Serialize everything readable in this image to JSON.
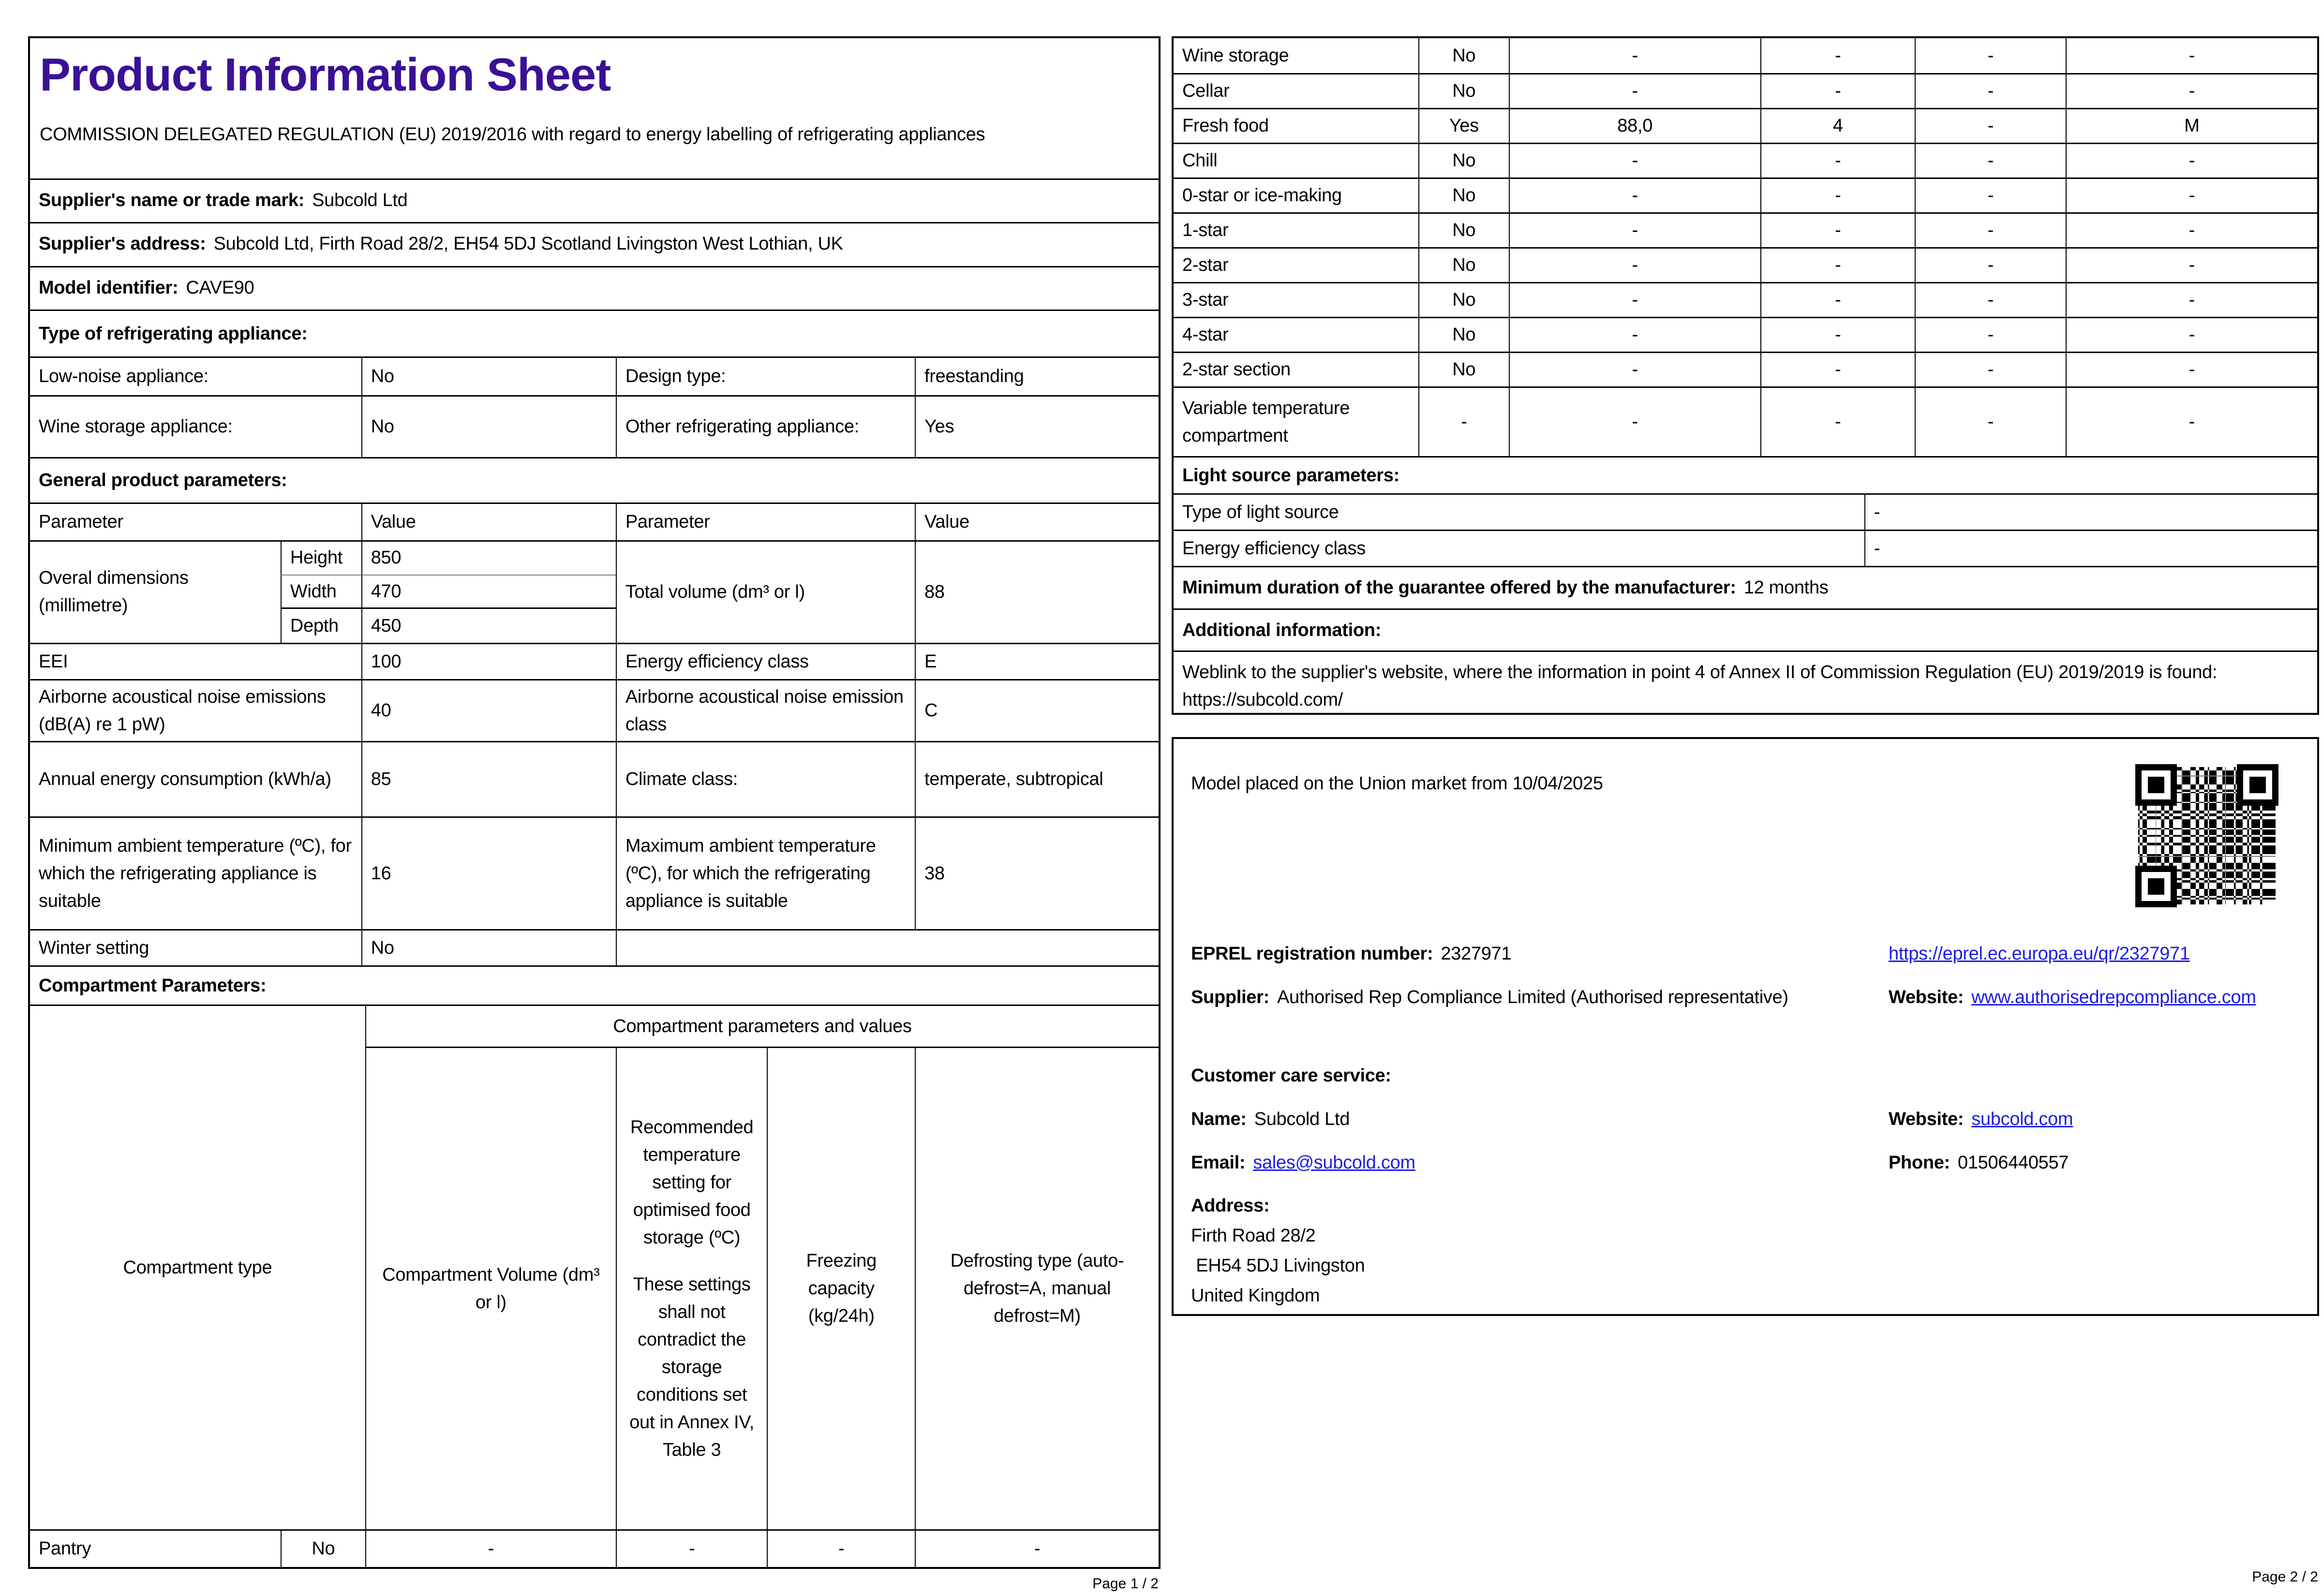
{
  "colors": {
    "title": "#3a1096",
    "link": "#1c1ce6"
  },
  "page1": {
    "title": "Product Information Sheet",
    "regulation": "COMMISSION DELEGATED REGULATION (EU) 2019/2016 with regard to energy labelling of refrigerating appliances",
    "supplier_name": {
      "label": "Supplier's name or trade mark:",
      "value": "Subcold Ltd"
    },
    "supplier_address": {
      "label": "Supplier's address:",
      "value": "Subcold Ltd, Firth Road 28/2, EH54 5DJ Scotland Livingston West Lothian, UK"
    },
    "model_identifier": {
      "label": "Model identifier:",
      "value": "CAVE90"
    },
    "type_heading": "Type of refrigerating appliance:",
    "type_table": {
      "row1": {
        "p1": "Low-noise appliance:",
        "v1": "No",
        "p2": "Design type:",
        "v2": "freestanding"
      },
      "row2": {
        "p1": "Wine storage appliance:",
        "v1": "No",
        "p2": "Other refrigerating appliance:",
        "v2": "Yes"
      }
    },
    "general_heading": "General product parameters:",
    "general_table": {
      "headers": {
        "h1": "Parameter",
        "h2": "Value",
        "h3": "Parameter",
        "h4": "Value"
      },
      "dimensions": {
        "label": "Overal dimensions (millimetre)",
        "height_label": "Height",
        "height": "850",
        "width_label": "Width",
        "width": "470",
        "depth_label": "Depth",
        "depth": "450",
        "p2": "Total volume (dm³ or l)",
        "v2": "88"
      },
      "eei": {
        "p1": "EEI",
        "v1": "100",
        "p2": "Energy efficiency class",
        "v2": "E"
      },
      "noise": {
        "p1": "Airborne acoustical noise emissions (dB(A) re 1 pW)",
        "v1": "40",
        "p2": "Airborne acoustical noise emission class",
        "v2": "C"
      },
      "energy": {
        "p1": "Annual energy consumption (kWh/a)",
        "v1": "85",
        "p2": "Climate class:",
        "v2": "temperate, subtropical"
      },
      "ambient": {
        "p1": "Minimum ambient temperature (ºC), for which the refrigerating appliance is suitable",
        "v1": "16",
        "p2": "Maximum ambient temperature (ºC), for which the refrigerating appliance is suitable",
        "v2": "38"
      },
      "winter": {
        "p1": "Winter setting",
        "v1": "No"
      }
    },
    "compartment_heading": "Compartment Parameters:",
    "compartment_table": {
      "span_header": "Compartment parameters and values",
      "type_header": "Compartment type",
      "volume_header": "Compartment Volume (dm³ or l)",
      "temperature_header_1": "Recommended temperature setting for optimised food storage (ºC)",
      "temperature_header_2": "These settings shall not contradict the storage conditions set out in Annex IV, Table 3",
      "freezing_header": "Freezing capacity (kg/24h)",
      "defrost_header": "Defrosting type (auto-defrost=A, manual defrost=M)",
      "rows": [
        {
          "name": "Pantry",
          "present": "No",
          "volume": "-",
          "temperature": "-",
          "freezing": "-",
          "defrost": "-"
        }
      ]
    },
    "footer": "Page 1 / 2"
  },
  "page2": {
    "compartment_rows": [
      {
        "name": "Wine storage",
        "present": "No",
        "volume": "-",
        "temperature": "-",
        "freezing": "-",
        "defrost": "-"
      },
      {
        "name": "Cellar",
        "present": "No",
        "volume": "-",
        "temperature": "-",
        "freezing": "-",
        "defrost": "-"
      },
      {
        "name": "Fresh food",
        "present": "Yes",
        "volume": "88,0",
        "temperature": "4",
        "freezing": "-",
        "defrost": "M"
      },
      {
        "name": "Chill",
        "present": "No",
        "volume": "-",
        "temperature": "-",
        "freezing": "-",
        "defrost": "-"
      },
      {
        "name": "0-star or ice-making",
        "present": "No",
        "volume": "-",
        "temperature": "-",
        "freezing": "-",
        "defrost": "-"
      },
      {
        "name": "1-star",
        "present": "No",
        "volume": "-",
        "temperature": "-",
        "freezing": "-",
        "defrost": "-"
      },
      {
        "name": "2-star",
        "present": "No",
        "volume": "-",
        "temperature": "-",
        "freezing": "-",
        "defrost": "-"
      },
      {
        "name": "3-star",
        "present": "No",
        "volume": "-",
        "temperature": "-",
        "freezing": "-",
        "defrost": "-"
      },
      {
        "name": "4-star",
        "present": "No",
        "volume": "-",
        "temperature": "-",
        "freezing": "-",
        "defrost": "-"
      },
      {
        "name": "2-star section",
        "present": "No",
        "volume": "-",
        "temperature": "-",
        "freezing": "-",
        "defrost": "-"
      },
      {
        "name": "Variable temperature compartment",
        "present": "-",
        "volume": "-",
        "temperature": "-",
        "freezing": "-",
        "defrost": "-"
      }
    ],
    "light_heading": "Light source parameters:",
    "light_rows": [
      {
        "label": "Type of light source",
        "value": "-"
      },
      {
        "label": "Energy efficiency class",
        "value": "-"
      }
    ],
    "guarantee": {
      "label": "Minimum duration of the guarantee offered by the manufacturer:",
      "value": "12 months"
    },
    "additional_heading": "Additional information:",
    "weblink": {
      "text": "Weblink to the supplier's website, where the information in point 4 of Annex II of Commission Regulation (EU) 2019/2019 is found:",
      "url": "https://subcold.com/"
    },
    "market": {
      "placed": "Model placed on the Union market from 10/04/2025",
      "eprel_label": "EPREL registration number:",
      "eprel_value": "2327971",
      "eprel_link": "https://eprel.ec.europa.eu/qr/2327971",
      "supplier_label": "Supplier:",
      "supplier_value": "Authorised Rep Compliance Limited (Authorised representative)",
      "website_label": "Website:",
      "supplier_website": "www.authorisedrepcompliance.com",
      "care_heading": "Customer care service:",
      "name_label": "Name:",
      "name_value": "Subcold Ltd",
      "care_website": "subcold.com",
      "email_label": "Email:",
      "email_value": "sales@subcold.com",
      "phone_label": "Phone:",
      "phone_value": "01506440557",
      "address_label": "Address:",
      "address_line1": "Firth Road 28/2",
      "address_line2": " EH54 5DJ Livingston",
      "address_line3": "United Kingdom"
    },
    "footer": "Page 2 / 2"
  }
}
